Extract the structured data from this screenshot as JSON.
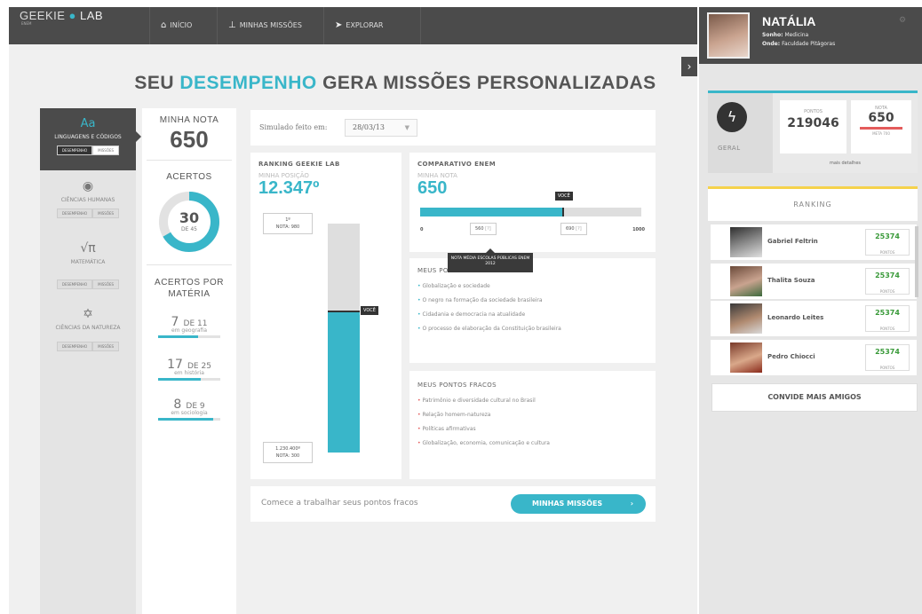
{
  "nav": {
    "logo": "GEEKIE",
    "logo_lab": "LAB",
    "logo_sub": "ENEM",
    "items": [
      {
        "label": "INÍCIO",
        "icon": "home-icon"
      },
      {
        "label": "MINHAS MISSÕES",
        "icon": "missions-icon"
      },
      {
        "label": "EXPLORAR",
        "icon": "explore-icon"
      }
    ]
  },
  "heading": {
    "part1": "SEU",
    "accent": "DESEMPENHO",
    "part2": "GERA MISSÕES PERSONALIZADAS"
  },
  "subjects": [
    {
      "name": "LINGUAGENS E CÓDIGOS",
      "icon_glyph": "Aa",
      "tab1": "DESEMPENHO",
      "tab2": "MISSÕES"
    },
    {
      "name": "CIÊNCIAS HUMANAS",
      "icon_glyph": "◉",
      "tab1": "DESEMPENHO",
      "tab2": "MISSÕES"
    },
    {
      "name": "MATEMÁTICA",
      "icon_glyph": "√π",
      "tab1": "DESEMPENHO",
      "tab2": "MISSÕES"
    },
    {
      "name": "CIÊNCIAS DA NATUREZA",
      "icon_glyph": "✡",
      "tab1": "DESEMPENHO",
      "tab2": "MISSÕES"
    }
  ],
  "score": {
    "label": "MINHA NOTA",
    "value": "650",
    "hits_label": "ACERTOS",
    "hits_value": "30",
    "hits_total": "DE 45",
    "hits_fraction": 0.667,
    "by_subject_label": "ACERTOS POR MATÉRIA",
    "by_subject": [
      {
        "count": "7",
        "of": "DE 11",
        "subject": "em geografia",
        "fraction": 0.636
      },
      {
        "count": "17",
        "of": "DE 25",
        "subject": "em história",
        "fraction": 0.68
      },
      {
        "count": "8",
        "of": "DE 9",
        "subject": "em sociologia",
        "fraction": 0.889
      }
    ]
  },
  "simulado": {
    "label": "Simulado feito em:",
    "date": "28/03/13"
  },
  "ranking_card": {
    "title": "RANKING GEEKIE LAB",
    "sub": "MINHA POSIÇÃO",
    "position": "12.347º",
    "top_label": "1º",
    "top_note": "NOTA: 980",
    "bottom_label": "1.230.400º",
    "bottom_note": "NOTA: 300",
    "you_tag": "VOCÊ",
    "fill_fraction": 0.62
  },
  "comparison_card": {
    "title": "COMPARATIVO ENEM",
    "sub": "MINHA NOTA",
    "value": "650",
    "you_tag": "VOCÊ",
    "scale_min": "0",
    "scale_max": "1000",
    "mark1": "560",
    "mark1_note": "[?]",
    "mark2": "690",
    "mark2_note": "[?]",
    "my_fraction": 0.65,
    "tooltip": "NOTA MÉDIA ESCOLAS PÚBLICAS ENEM 2012"
  },
  "strong": {
    "title": "MEUS PONTOS FORTES",
    "items": [
      "Globalização e sociedade",
      "O negro na formação da sociedade brasileira",
      "Cidadania e democracia na atualidade",
      "O processo de elaboração da Constituição brasileira"
    ]
  },
  "weak": {
    "title": "MEUS PONTOS FRACOS",
    "items": [
      "Patrimônio e diversidade cultural no Brasil",
      "Relação homem-natureza",
      "Políticas afirmativas",
      "Globalização, economia, comunicação e cultura"
    ]
  },
  "cta": {
    "text": "Comece a trabalhar seus pontos fracos",
    "button": "MINHAS MISSÕES"
  },
  "profile": {
    "name": "NATÁLIA",
    "dream_label": "Sonho:",
    "dream": "Medicina",
    "where_label": "Onde:",
    "where": "Faculdade Pitágoras"
  },
  "summary": {
    "geral": "GERAL",
    "points_label": "PONTOS",
    "points": "219046",
    "nota_label": "NOTA",
    "nota": "650",
    "meta": "META 700",
    "details": "mais detalhes"
  },
  "ranking": {
    "title": "RANKING",
    "unit": "PONTOS",
    "rows": [
      {
        "name": "Gabriel Feltrin",
        "points": "25374"
      },
      {
        "name": "Thalita Souza",
        "points": "25374"
      },
      {
        "name": "Leonardo Leites",
        "points": "25374"
      },
      {
        "name": "Pedro Chiocci",
        "points": "25374"
      }
    ],
    "invite": "CONVIDE MAIS AMIGOS"
  },
  "colors": {
    "accent": "#39b6c9",
    "dark": "#4b4b4b",
    "weak": "#e45b5b",
    "points": "#3a9a3a"
  }
}
